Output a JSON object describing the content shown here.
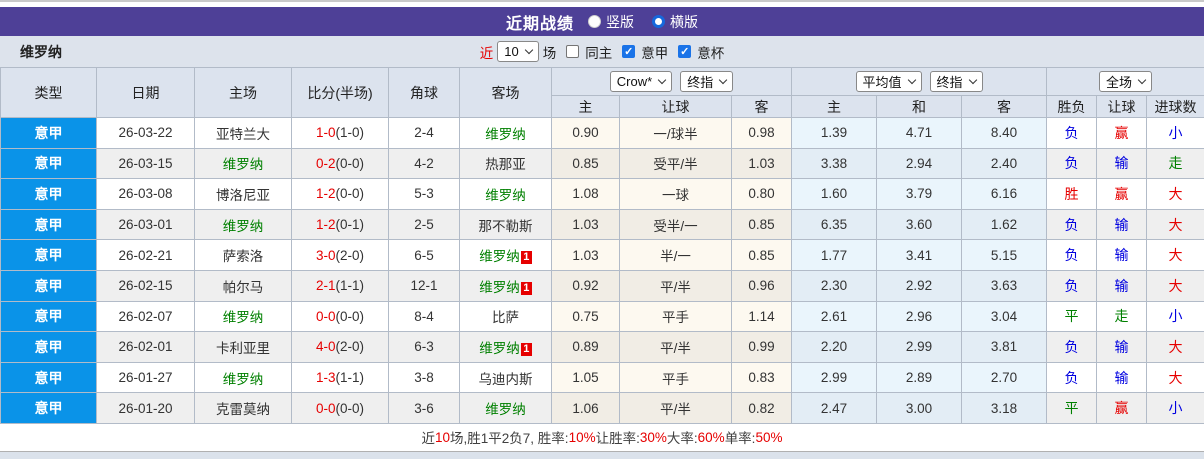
{
  "title_bar": {
    "title": "近期战绩",
    "radios": [
      {
        "label": "竖版",
        "checked": false
      },
      {
        "label": "横版",
        "checked": true
      }
    ]
  },
  "filter_bar": {
    "team": "维罗纳",
    "recent_label": "近",
    "recent_value": "10",
    "games_label": "场",
    "checkboxes": [
      {
        "label": "同主",
        "checked": false
      },
      {
        "label": "意甲",
        "checked": true
      },
      {
        "label": "意杯",
        "checked": true
      }
    ]
  },
  "table": {
    "main_headers": [
      "类型",
      "日期",
      "主场",
      "比分(半场)",
      "角球",
      "客场"
    ],
    "selects": {
      "company": "Crow*",
      "company_stage": "终指",
      "average": "平均值",
      "average_stage": "终指",
      "scope": "全场"
    },
    "sub_headers": [
      "主",
      "让球",
      "客",
      "主",
      "和",
      "客",
      "胜负",
      "让球",
      "进球数"
    ],
    "rows": [
      {
        "league": "意甲",
        "date": "26-03-22",
        "home": "亚特兰大",
        "home_color": "black",
        "home_badge": null,
        "score": "1-0",
        "half": "1-0",
        "corner": "2-4",
        "away": "维罗纳",
        "away_color": "green",
        "away_badge": null,
        "odds": [
          "0.90",
          "一/球半",
          "0.98"
        ],
        "avg": [
          "1.39",
          "4.71",
          "8.40"
        ],
        "result": {
          "text": "负",
          "color": "blue"
        },
        "handicap": {
          "text": "赢",
          "color": "red"
        },
        "goals": {
          "text": "小",
          "color": "blue"
        }
      },
      {
        "league": "意甲",
        "date": "26-03-15",
        "home": "维罗纳",
        "home_color": "green",
        "home_badge": null,
        "score": "0-2",
        "half": "0-0",
        "corner": "4-2",
        "away": "热那亚",
        "away_color": "black",
        "away_badge": null,
        "odds": [
          "0.85",
          "受平/半",
          "1.03"
        ],
        "avg": [
          "3.38",
          "2.94",
          "2.40"
        ],
        "result": {
          "text": "负",
          "color": "blue"
        },
        "handicap": {
          "text": "输",
          "color": "blue"
        },
        "goals": {
          "text": "走",
          "color": "green"
        }
      },
      {
        "league": "意甲",
        "date": "26-03-08",
        "home": "博洛尼亚",
        "home_color": "black",
        "home_badge": null,
        "score": "1-2",
        "half": "0-0",
        "corner": "5-3",
        "away": "维罗纳",
        "away_color": "green",
        "away_badge": null,
        "odds": [
          "1.08",
          "一球",
          "0.80"
        ],
        "avg": [
          "1.60",
          "3.79",
          "6.16"
        ],
        "result": {
          "text": "胜",
          "color": "red"
        },
        "handicap": {
          "text": "赢",
          "color": "red"
        },
        "goals": {
          "text": "大",
          "color": "red"
        }
      },
      {
        "league": "意甲",
        "date": "26-03-01",
        "home": "维罗纳",
        "home_color": "green",
        "home_badge": null,
        "score": "1-2",
        "half": "0-1",
        "corner": "2-5",
        "away": "那不勒斯",
        "away_color": "black",
        "away_badge": null,
        "odds": [
          "1.03",
          "受半/一",
          "0.85"
        ],
        "avg": [
          "6.35",
          "3.60",
          "1.62"
        ],
        "result": {
          "text": "负",
          "color": "blue"
        },
        "handicap": {
          "text": "输",
          "color": "blue"
        },
        "goals": {
          "text": "大",
          "color": "red"
        }
      },
      {
        "league": "意甲",
        "date": "26-02-21",
        "home": "萨索洛",
        "home_color": "black",
        "home_badge": null,
        "score": "3-0",
        "half": "2-0",
        "corner": "6-5",
        "away": "维罗纳",
        "away_color": "green",
        "away_badge": "1",
        "odds": [
          "1.03",
          "半/一",
          "0.85"
        ],
        "avg": [
          "1.77",
          "3.41",
          "5.15"
        ],
        "result": {
          "text": "负",
          "color": "blue"
        },
        "handicap": {
          "text": "输",
          "color": "blue"
        },
        "goals": {
          "text": "大",
          "color": "red"
        }
      },
      {
        "league": "意甲",
        "date": "26-02-15",
        "home": "帕尔马",
        "home_color": "black",
        "home_badge": null,
        "score": "2-1",
        "half": "1-1",
        "corner": "12-1",
        "away": "维罗纳",
        "away_color": "green",
        "away_badge": "1",
        "odds": [
          "0.92",
          "平/半",
          "0.96"
        ],
        "avg": [
          "2.30",
          "2.92",
          "3.63"
        ],
        "result": {
          "text": "负",
          "color": "blue"
        },
        "handicap": {
          "text": "输",
          "color": "blue"
        },
        "goals": {
          "text": "大",
          "color": "red"
        }
      },
      {
        "league": "意甲",
        "date": "26-02-07",
        "home": "维罗纳",
        "home_color": "green",
        "home_badge": null,
        "score": "0-0",
        "half": "0-0",
        "corner": "8-4",
        "away": "比萨",
        "away_color": "black",
        "away_badge": null,
        "odds": [
          "0.75",
          "平手",
          "1.14"
        ],
        "avg": [
          "2.61",
          "2.96",
          "3.04"
        ],
        "result": {
          "text": "平",
          "color": "green"
        },
        "handicap": {
          "text": "走",
          "color": "green"
        },
        "goals": {
          "text": "小",
          "color": "blue"
        }
      },
      {
        "league": "意甲",
        "date": "26-02-01",
        "home": "卡利亚里",
        "home_color": "black",
        "home_badge": null,
        "score": "4-0",
        "half": "2-0",
        "corner": "6-3",
        "away": "维罗纳",
        "away_color": "green",
        "away_badge": "1",
        "odds": [
          "0.89",
          "平/半",
          "0.99"
        ],
        "avg": [
          "2.20",
          "2.99",
          "3.81"
        ],
        "result": {
          "text": "负",
          "color": "blue"
        },
        "handicap": {
          "text": "输",
          "color": "blue"
        },
        "goals": {
          "text": "大",
          "color": "red"
        }
      },
      {
        "league": "意甲",
        "date": "26-01-27",
        "home": "维罗纳",
        "home_color": "green",
        "home_badge": null,
        "score": "1-3",
        "half": "1-1",
        "corner": "3-8",
        "away": "乌迪内斯",
        "away_color": "black",
        "away_badge": null,
        "odds": [
          "1.05",
          "平手",
          "0.83"
        ],
        "avg": [
          "2.99",
          "2.89",
          "2.70"
        ],
        "result": {
          "text": "负",
          "color": "blue"
        },
        "handicap": {
          "text": "输",
          "color": "blue"
        },
        "goals": {
          "text": "大",
          "color": "red"
        }
      },
      {
        "league": "意甲",
        "date": "26-01-20",
        "home": "克雷莫纳",
        "home_color": "black",
        "home_badge": null,
        "score": "0-0",
        "half": "0-0",
        "corner": "3-6",
        "away": "维罗纳",
        "away_color": "green",
        "away_badge": null,
        "odds": [
          "1.06",
          "平/半",
          "0.82"
        ],
        "avg": [
          "2.47",
          "3.00",
          "3.18"
        ],
        "result": {
          "text": "平",
          "color": "green"
        },
        "handicap": {
          "text": "赢",
          "color": "red"
        },
        "goals": {
          "text": "小",
          "color": "blue"
        }
      }
    ]
  },
  "summary": {
    "segments": [
      [
        "近",
        "dark"
      ],
      [
        "10",
        "red"
      ],
      [
        "场,胜1平2负7, 胜率:",
        "dark"
      ],
      [
        "10%",
        "red"
      ],
      [
        " 让胜率:",
        "dark"
      ],
      [
        "30%",
        "red"
      ],
      [
        " 大率:",
        "dark"
      ],
      [
        "60%",
        "red"
      ],
      [
        " 单率:",
        "dark"
      ],
      [
        "50%",
        "red"
      ]
    ]
  },
  "colors": {
    "accent_purple": "#4e4097",
    "league_blue": "#0a93e8",
    "team_green": "#008000",
    "score_red": "#e60000",
    "result_blue": "#0000e0"
  }
}
